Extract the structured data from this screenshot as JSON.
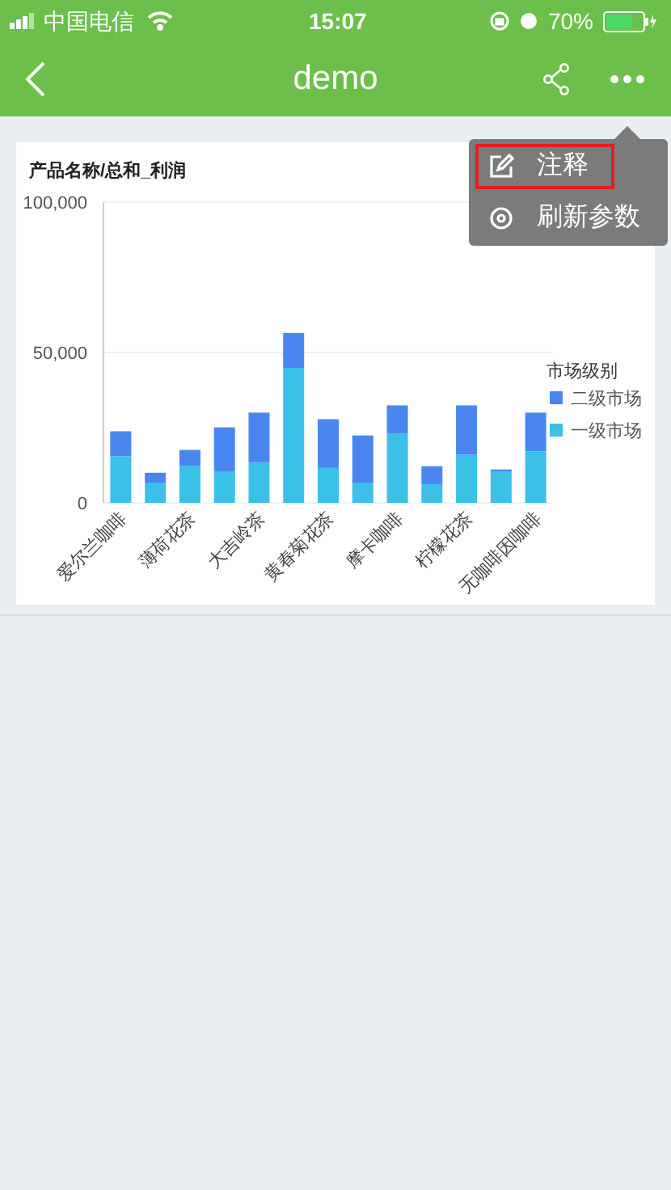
{
  "status_bar": {
    "carrier": "中国电信",
    "time": "15:07",
    "battery": "70%"
  },
  "nav": {
    "title": "demo"
  },
  "chart_card": {
    "title": "产品名称/总和_利润",
    "chart_data": {
      "type": "bar",
      "stacked": true,
      "categories": [
        "爱尔兰咖啡",
        null,
        "薄荷花茶",
        null,
        "大吉岭茶",
        null,
        "黄春菊花茶",
        null,
        "摩卡咖啡",
        null,
        "柠檬花茶",
        null,
        "无咖啡因咖啡"
      ],
      "ylim": [
        0,
        100000
      ],
      "yticks": [
        {
          "value": 0,
          "label": "0"
        },
        {
          "value": 50000,
          "label": "50,000"
        },
        {
          "value": 100000,
          "label": "100,000"
        }
      ],
      "legend": {
        "title": "市场级别"
      },
      "series": [
        {
          "name": "一级市场",
          "color": "#3bc0e8",
          "values": [
            15500,
            6700,
            12200,
            10500,
            13500,
            44900,
            11600,
            6700,
            23100,
            6200,
            16000,
            10500,
            17100
          ]
        },
        {
          "name": "二级市场",
          "color": "#4a86f0",
          "values": [
            8300,
            3300,
            5400,
            14600,
            16500,
            11600,
            16200,
            15700,
            9300,
            6000,
            16400,
            600,
            12900
          ]
        }
      ]
    }
  },
  "menu": {
    "items": [
      {
        "kind": "annotate",
        "label": "注释",
        "highlighted": true
      },
      {
        "kind": "refresh",
        "label": "刷新参数",
        "highlighted": false
      }
    ]
  }
}
